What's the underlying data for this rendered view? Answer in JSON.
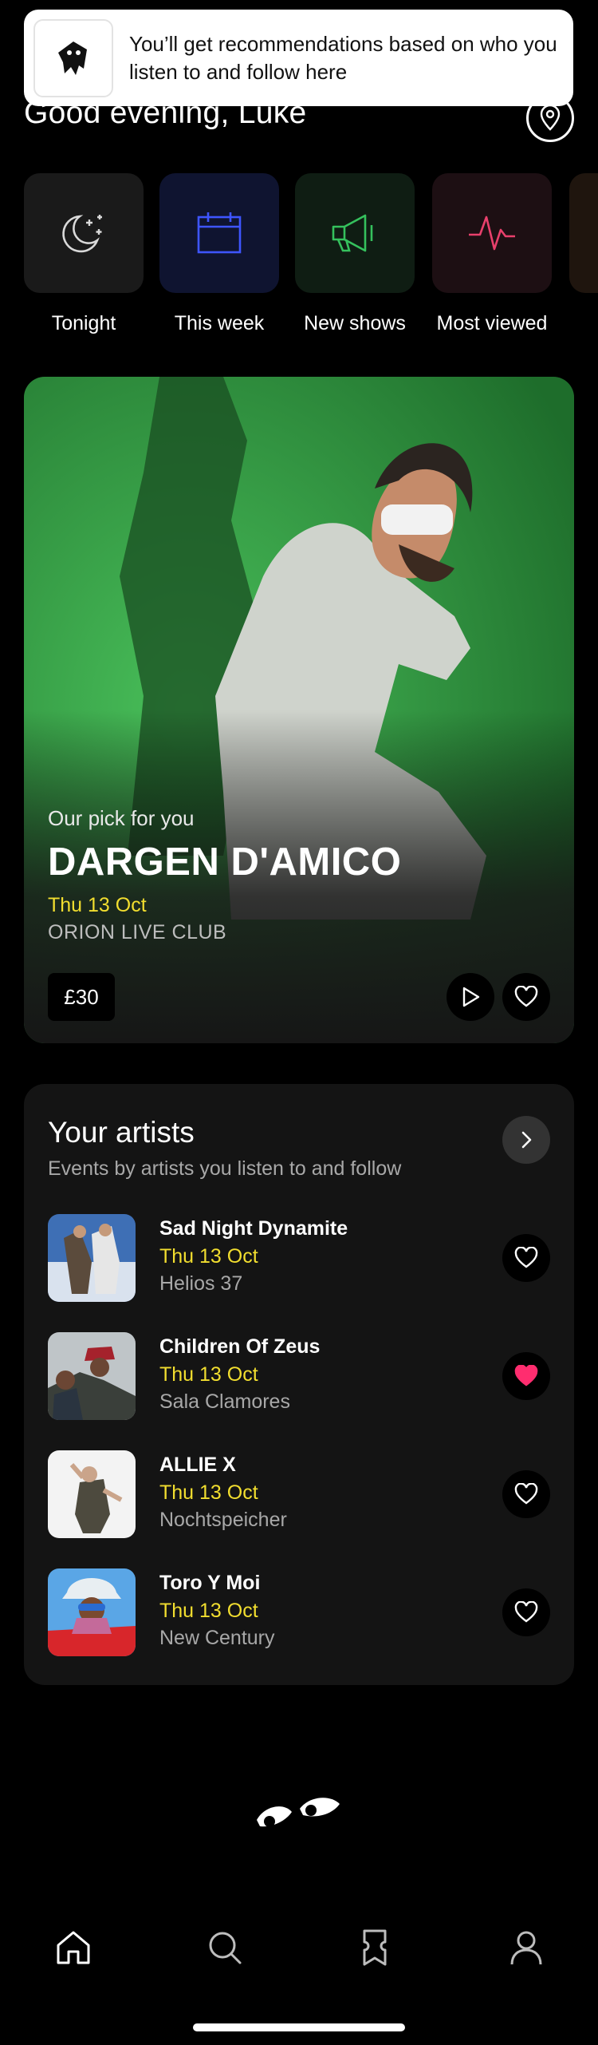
{
  "toast": {
    "message": "You’ll get recommendations based on who you listen to and follow here",
    "logo_icon": "ghost-mascot-icon"
  },
  "header": {
    "greeting": "Good evening, Luke",
    "location_icon": "location-pin-icon"
  },
  "categories": [
    {
      "label": "Tonight",
      "icon": "moon-stars-icon",
      "color": "#d9d9d9",
      "bg": "#1a1a1a"
    },
    {
      "label": "This week",
      "icon": "calendar-icon",
      "color": "#3e55ff",
      "bg": "#0f1430"
    },
    {
      "label": "New shows",
      "icon": "megaphone-icon",
      "color": "#35c15d",
      "bg": "#0f1d13"
    },
    {
      "label": "Most viewed",
      "icon": "pulse-icon",
      "color": "#e8406c",
      "bg": "#1d0f13"
    }
  ],
  "hero": {
    "eyebrow": "Our pick for you",
    "title": "DARGEN D'AMICO",
    "date": "Thu 13 Oct",
    "venue": "ORION LIVE CLUB",
    "price": "£30",
    "play_icon": "play-icon",
    "favorite_icon": "heart-outline-icon"
  },
  "artists": {
    "title": "Your artists",
    "subtitle": "Events by artists you listen to and follow",
    "items": [
      {
        "name": "Sad Night Dynamite",
        "date": "Thu 13 Oct",
        "venue": "Helios 37",
        "favorited": false
      },
      {
        "name": "Children Of Zeus",
        "date": "Thu 13 Oct",
        "venue": "Sala Clamores",
        "favorited": true
      },
      {
        "name": "ALLIE X",
        "date": "Thu 13 Oct",
        "venue": "Nochtspeicher",
        "favorited": false
      },
      {
        "name": "Toro Y Moi",
        "date": "Thu 13 Oct",
        "venue": "New Century",
        "favorited": false
      }
    ]
  },
  "tabbar": {
    "icons": [
      "home-icon",
      "search-icon",
      "tickets-icon",
      "profile-icon"
    ],
    "active": "home-icon"
  },
  "colors": {
    "accent_yellow": "#f2de2f",
    "favorite_pink": "#ff2d6f",
    "background": "#000000",
    "card": "#141414"
  }
}
